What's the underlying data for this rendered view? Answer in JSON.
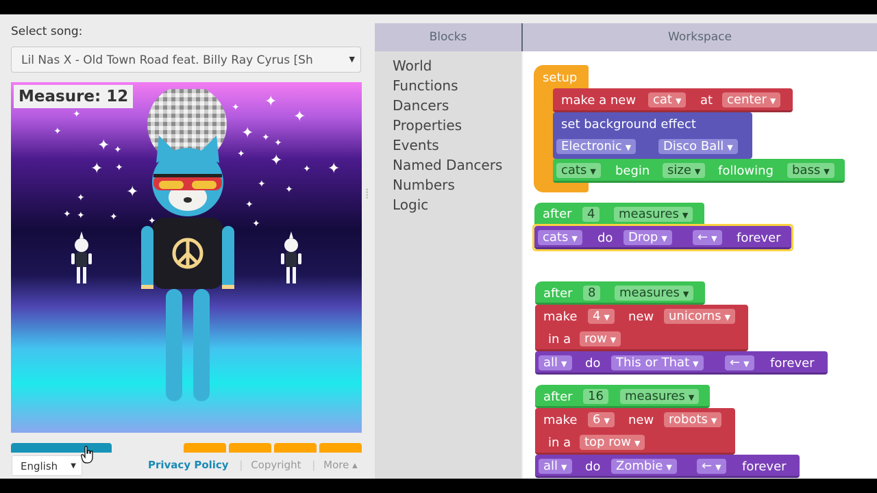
{
  "song_selector": {
    "label": "Select song:",
    "selected": "Lil Nas X - Old Town Road feat. Billy Ray Cyrus [Sh"
  },
  "stage": {
    "measure_label": "Measure: 12"
  },
  "footer": {
    "language": "English",
    "privacy": "Privacy Policy",
    "copyright": "Copyright",
    "more": "More ▴"
  },
  "panes": {
    "blocks_header": "Blocks",
    "workspace_header": "Workspace"
  },
  "toolbox": {
    "categories": [
      "World",
      "Functions",
      "Dancers",
      "Properties",
      "Events",
      "Named Dancers",
      "Numbers",
      "Logic"
    ]
  },
  "blocks": {
    "setup": {
      "hat": "setup",
      "make_new": "make a new",
      "make_dancer": "cat",
      "at": "at",
      "position": "center",
      "set_bg": "set background effect",
      "bg_palette": "Electronic",
      "bg_effect": "Disco Ball",
      "group": "cats",
      "begin": "begin",
      "property": "size",
      "following": "following",
      "band": "bass"
    },
    "ev1": {
      "after": "after",
      "count": "4",
      "measures": "measures",
      "group": "cats",
      "do": "do",
      "move": "Drop",
      "dir": "←",
      "forever": "forever"
    },
    "ev2": {
      "after": "after",
      "count": "8",
      "measures": "measures",
      "make": "make",
      "qty": "4",
      "new": "new",
      "dancer": "unicorns",
      "in_a": "in a",
      "layout": "row",
      "group": "all",
      "do": "do",
      "move": "This or That",
      "dir": "←",
      "forever": "forever"
    },
    "ev3": {
      "after": "after",
      "count": "16",
      "measures": "measures",
      "make": "make",
      "qty": "6",
      "new": "new",
      "dancer": "robots",
      "in_a": "in a",
      "layout": "top row",
      "group": "all",
      "do": "do",
      "move": "Zombie",
      "dir": "←",
      "forever": "forever"
    }
  }
}
